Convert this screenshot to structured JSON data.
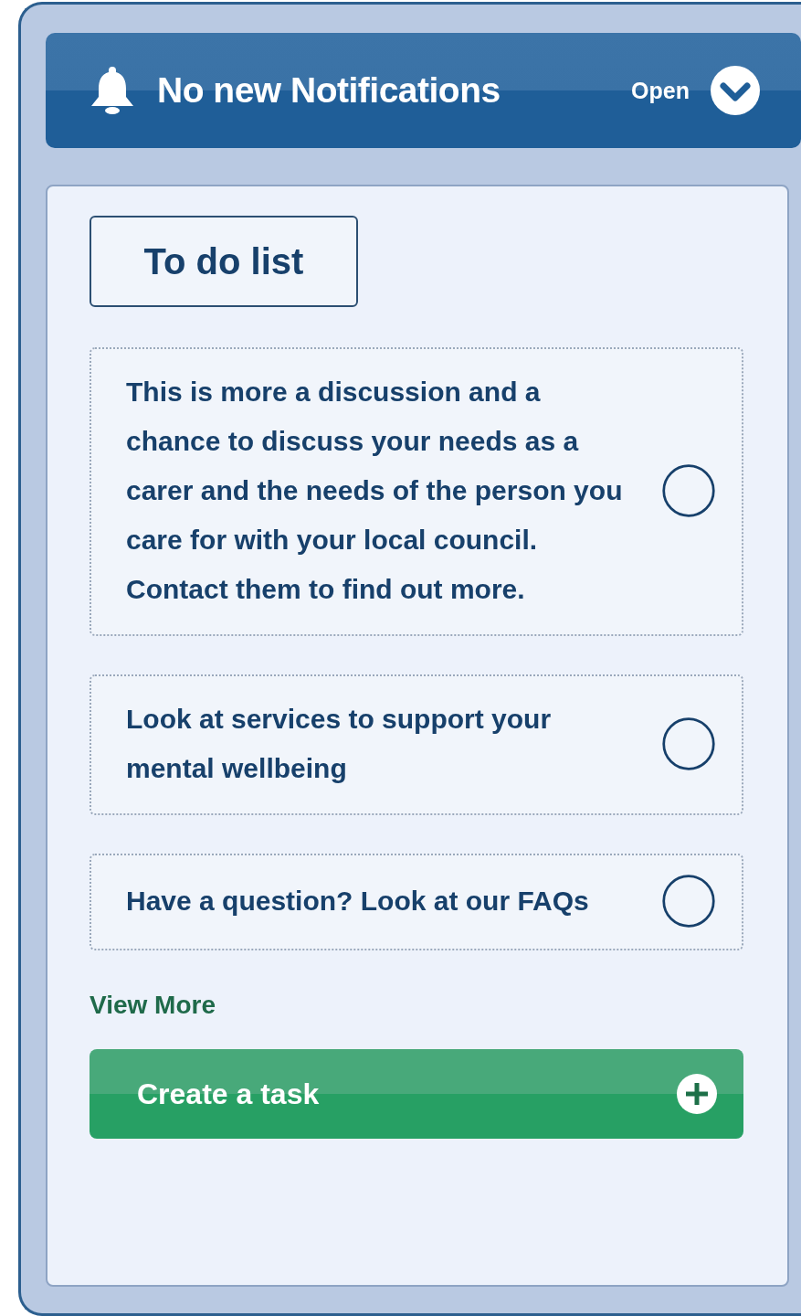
{
  "notifications": {
    "title": "No new Notifications",
    "toggle_label": "Open",
    "expanded": false
  },
  "todo": {
    "tab_label": "To do list",
    "tasks": [
      {
        "text": "This is more a discussion and a chance to discuss your needs as a carer and the needs of the person you care for with your local council. Contact them to find out more.",
        "checked": false
      },
      {
        "text": "Look at services to support your mental wellbeing",
        "checked": false
      },
      {
        "text": "Have a question? Look at our FAQs",
        "checked": false
      }
    ],
    "view_more": "View More",
    "create_button": "Create a task"
  }
}
